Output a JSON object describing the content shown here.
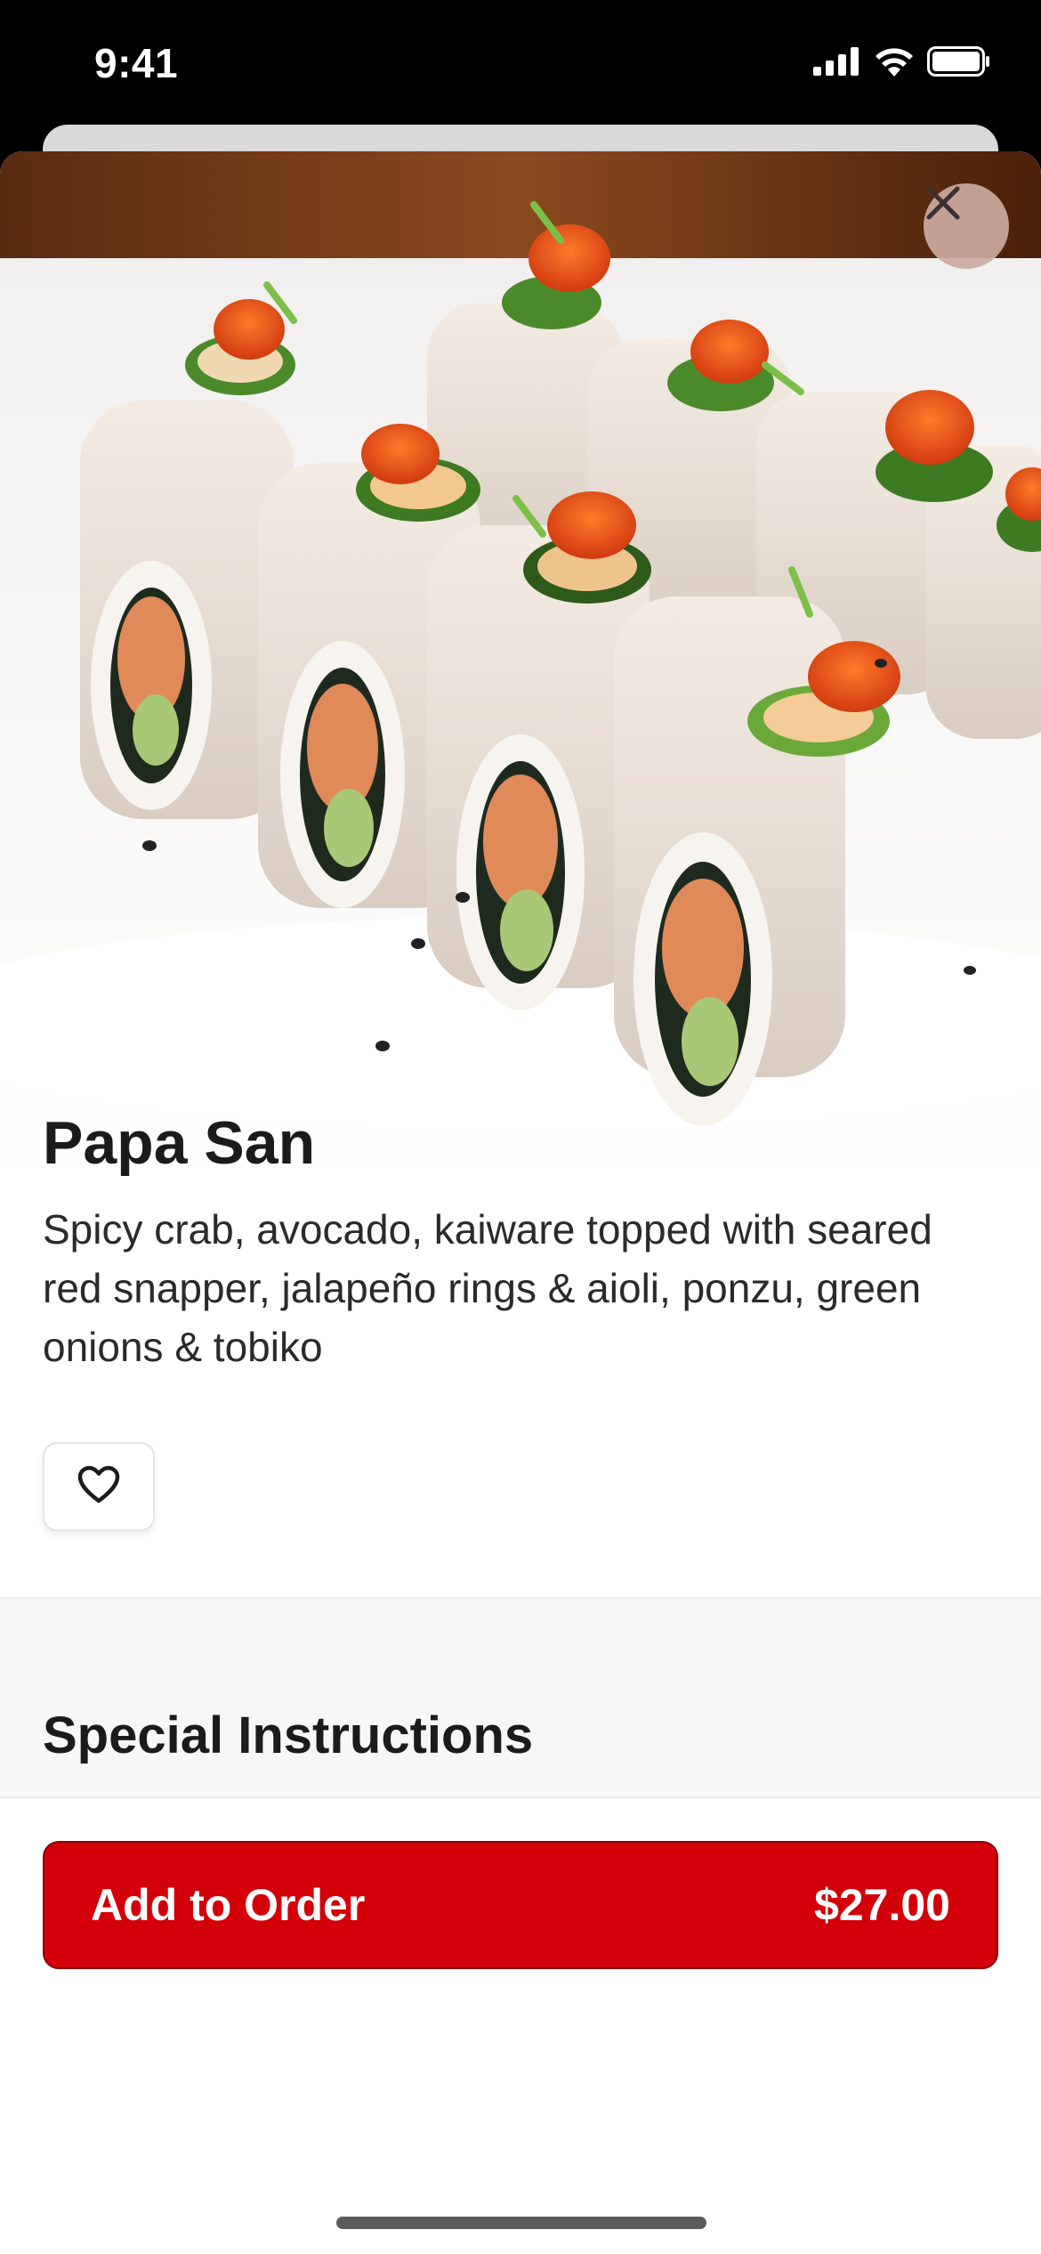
{
  "status_bar": {
    "time": "9:41",
    "icons": [
      "signal-icon",
      "wifi-icon",
      "battery-icon"
    ]
  },
  "item": {
    "title": "Papa San",
    "description": "Spicy crab, avocado, kaiware topped with seared red snapper, jalapeño rings & aioli, ponzu, green onions & tobiko",
    "image_icon": "sushi-roll-photo"
  },
  "actions": {
    "close_icon": "close-icon",
    "favorite_icon": "heart-icon"
  },
  "instructions": {
    "heading": "Special Instructions"
  },
  "order_button": {
    "label": "Add to Order",
    "price": "$27.00"
  },
  "colors": {
    "accent": "#d30009",
    "close_bg": "#ccaaa0"
  }
}
